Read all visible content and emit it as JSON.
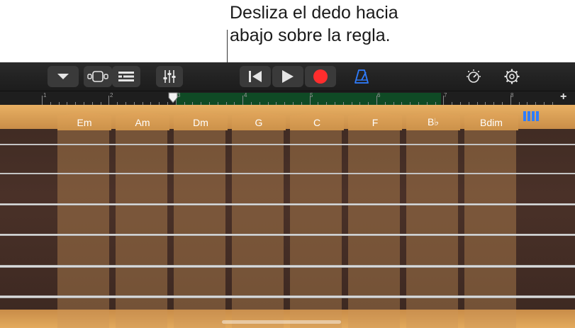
{
  "callout": {
    "text": "Desliza el dedo hacia\nabajo sobre la regla."
  },
  "toolbar": {
    "icons": [
      "chevron-down-icon",
      "browser-view-icon",
      "tracks-view-icon",
      "mixer-icon",
      "rewind-icon",
      "play-icon",
      "record-icon",
      "metronome-icon",
      "master-effects-icon",
      "settings-gear-icon"
    ],
    "accent": "#2f7dff",
    "record_color": "#ff2d2d"
  },
  "ruler": {
    "bars": [
      "1",
      "2",
      "3",
      "4",
      "5",
      "6",
      "7",
      "8"
    ],
    "add_label": "+",
    "region_color": "#0f4a25"
  },
  "chords": [
    "Em",
    "Am",
    "Dm",
    "G",
    "C",
    "F",
    "B♭",
    "Bdim"
  ],
  "strings_count": 6
}
